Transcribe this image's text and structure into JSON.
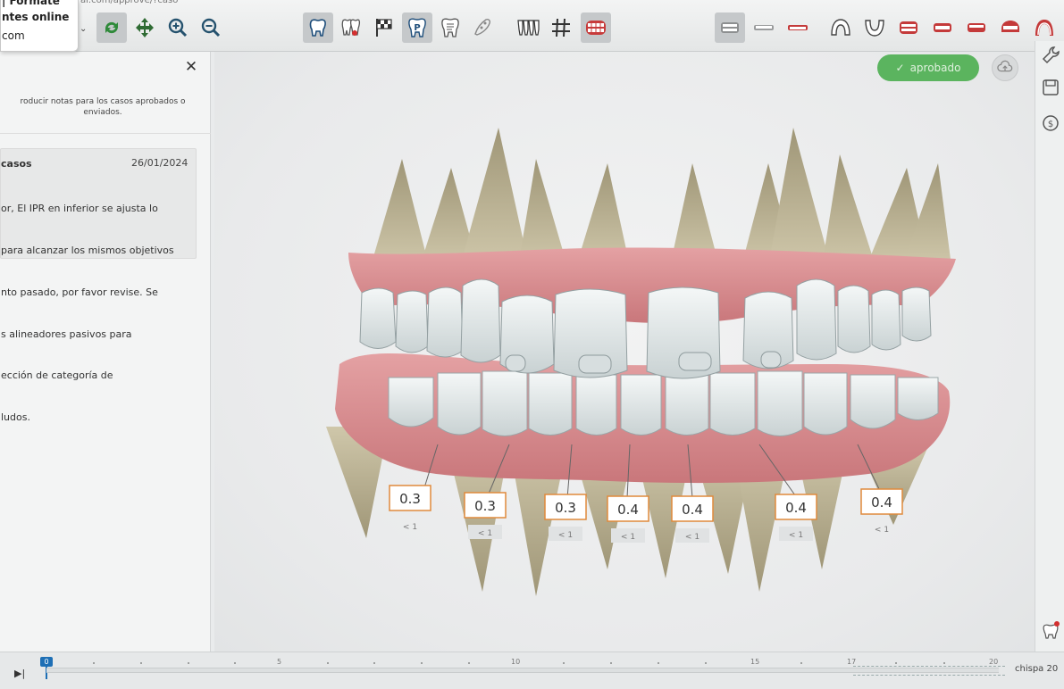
{
  "browser_tab": {
    "line1": "| Formate",
    "line2": "ntes online",
    "line3": "com",
    "url_fragment": "ai.com/approve/?caso"
  },
  "toolbar": {
    "left_tools": [
      "caret-down-icon",
      "sync-icon",
      "move-icon",
      "zoom-in-icon",
      "zoom-out-icon"
    ],
    "view_tools": [
      "tooth-icon",
      "teeth-red-icon",
      "flag-icon",
      "p-icon",
      "tooth-notes-icon",
      "tooth-outline-icon",
      "arch-icon",
      "grid-icon",
      "mouth-icon"
    ],
    "right_tools": [
      "front-view-icon",
      "lower-view-icon",
      "upper-view-icon",
      "upper-arch-icon",
      "lower-arch-icon",
      "left-view-icon",
      "right-view-icon",
      "side-view-icon",
      "bite-view-icon",
      "occlusal-icon"
    ]
  },
  "notes": {
    "info": "roducir notas para los casos aprobados o enviados.",
    "card": {
      "author": "casos",
      "date": "26/01/2024",
      "body_lines": [
        "or, El IPR en inferior se ajusta lo",
        "para alcanzar los mismos objetivos",
        "nto pasado, por favor revise. Se",
        "s alineadores pasivos para",
        "ección de categoría de",
        "ludos."
      ]
    }
  },
  "viewer": {
    "status_label": "aprobado",
    "ipr_labels": [
      {
        "value": "0.3",
        "sub": "< 1"
      },
      {
        "value": "0.3",
        "sub": "< 1"
      },
      {
        "value": "0.3",
        "sub": "< 1"
      },
      {
        "value": "0.4",
        "sub": "< 1"
      },
      {
        "value": "0.4",
        "sub": "< 1"
      },
      {
        "value": "0.4",
        "sub": "< 1"
      },
      {
        "value": "0.4",
        "sub": "< 1"
      }
    ]
  },
  "timeline": {
    "current_stage": "0",
    "ticks": [
      "5",
      "10",
      "15",
      "17",
      "20"
    ],
    "stage_label": "chispa 20"
  },
  "colors": {
    "approved": "#4caf50",
    "stage_marker": "#1e6fb5",
    "ipr_border": "#e08a3c",
    "gum": "#d98b8f",
    "tooth": "#e6ecec",
    "root": "#bfb89c"
  }
}
